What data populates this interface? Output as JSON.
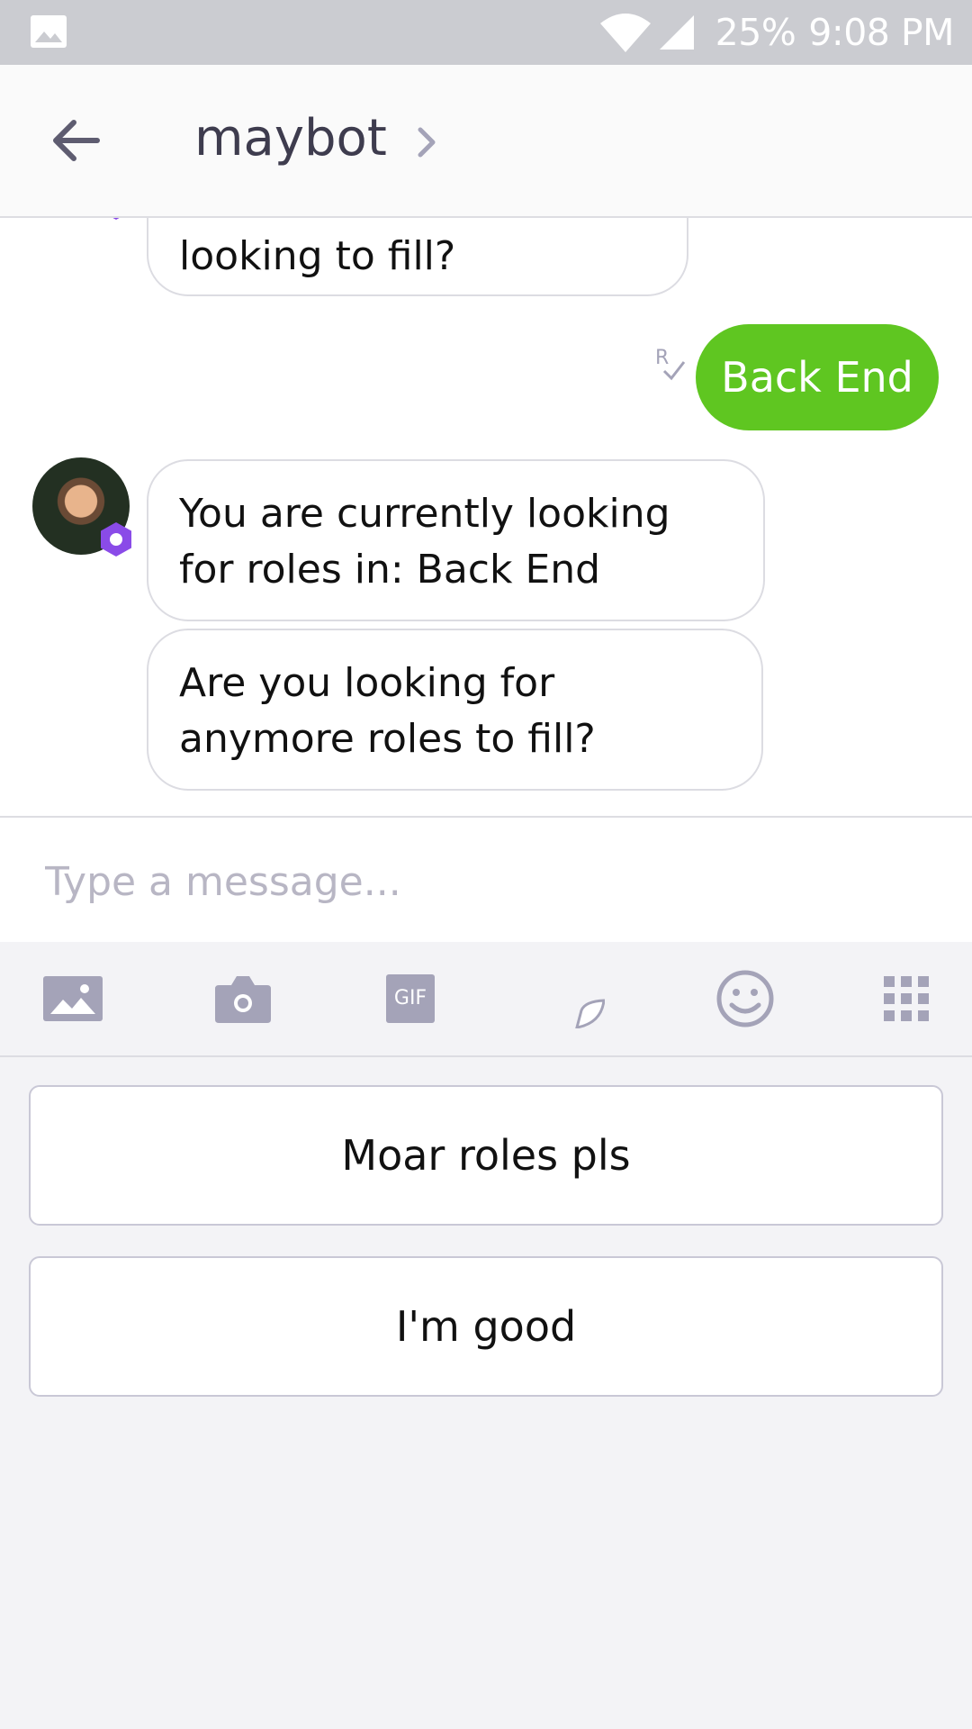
{
  "status_bar": {
    "battery": "25%",
    "time": "9:08 PM",
    "icons": [
      "photo-icon",
      "wifi-icon",
      "signal-icon"
    ]
  },
  "header": {
    "title": "maybot",
    "back_icon": "arrow-left-icon",
    "details_icon": "chevron-right-icon"
  },
  "messages": [
    {
      "from": "bot",
      "text": "looking to fill?"
    },
    {
      "from": "user",
      "text": "Back End",
      "receipt": "R",
      "color": "#5fc621"
    },
    {
      "from": "bot",
      "text": "You are currently looking for roles in: Back End"
    },
    {
      "from": "bot",
      "text": "Are you looking for anymore roles to fill?"
    }
  ],
  "composer": {
    "placeholder": "Type a message..."
  },
  "toolbar": {
    "gif_label": "GIF",
    "icons": [
      "image-icon",
      "camera-icon",
      "gif-icon",
      "sticker-icon",
      "emoji-icon",
      "apps-grid-icon"
    ]
  },
  "quick_replies": [
    "Moar roles pls",
    "I'm good"
  ],
  "colors": {
    "accent_green": "#5fc621",
    "bot_badge": "#8a4be8",
    "icon_gray": "#a4a3b8"
  }
}
